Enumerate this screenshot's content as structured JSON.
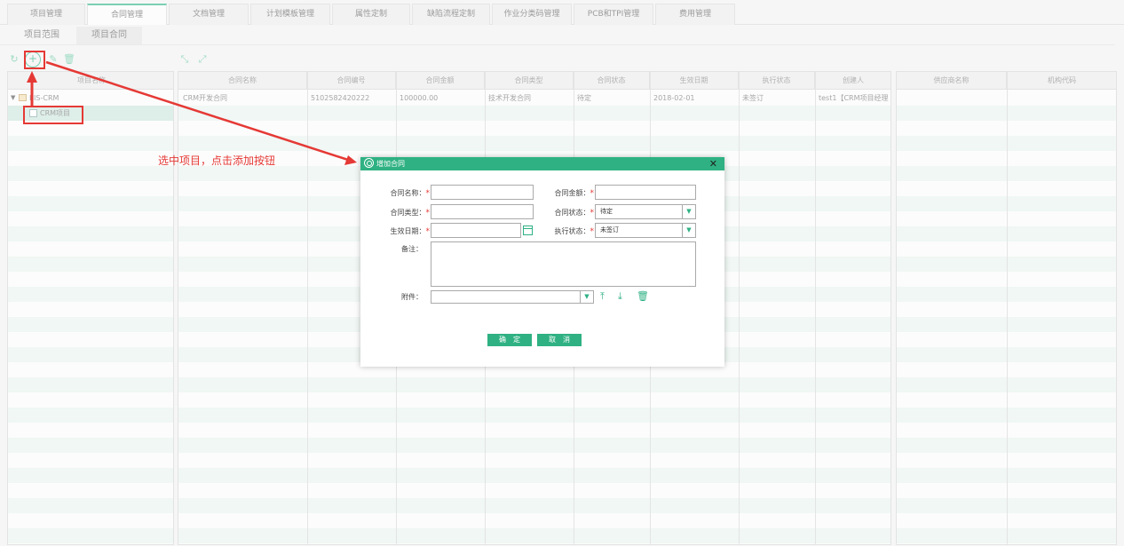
{
  "top_tabs": [
    "项目管理",
    "合同管理",
    "文档管理",
    "计划模板管理",
    "属性定制",
    "缺陷流程定制",
    "作业分类码管理",
    "PCB和TPI管理",
    "费用管理"
  ],
  "sub_tabs": [
    "项目范围",
    "项目合同"
  ],
  "tree": {
    "header": "项目名称",
    "root_label": "EIS-CRM",
    "child_label": "CRM项目"
  },
  "contract_table": {
    "headers": [
      "合同名称",
      "合同编号",
      "合同金额",
      "合同类型",
      "合同状态",
      "生效日期",
      "执行状态",
      "创建人"
    ],
    "row": [
      "CRM开发合同",
      "5102582420222",
      "100000.00",
      "技术开发合同",
      "待定",
      "2018-02-01",
      "未签订",
      "test1【CRM项目经理"
    ]
  },
  "supplier_table": {
    "headers": [
      "供应商名称",
      "机构代码"
    ]
  },
  "annotation": {
    "text": "选中项目，点击添加按钮"
  },
  "dialog": {
    "title": "增加合同",
    "close": "✕",
    "labels": {
      "name": "合同名称：",
      "amount": "合同金额：",
      "type": "合同类型：",
      "status": "合同状态：",
      "effective_date": "生效日期：",
      "exec_status": "执行状态：",
      "remark": "备注：",
      "attachment": "附件："
    },
    "values": {
      "name": "",
      "amount": "",
      "type": "",
      "status": "待定",
      "effective_date": "",
      "exec_status": "未签订",
      "remark": "",
      "attachment": ""
    },
    "required_mark": "*",
    "buttons": {
      "ok": "确　定",
      "cancel": "取　消"
    }
  },
  "colors": {
    "accent": "#2fb183",
    "annotation": "#e53935"
  }
}
